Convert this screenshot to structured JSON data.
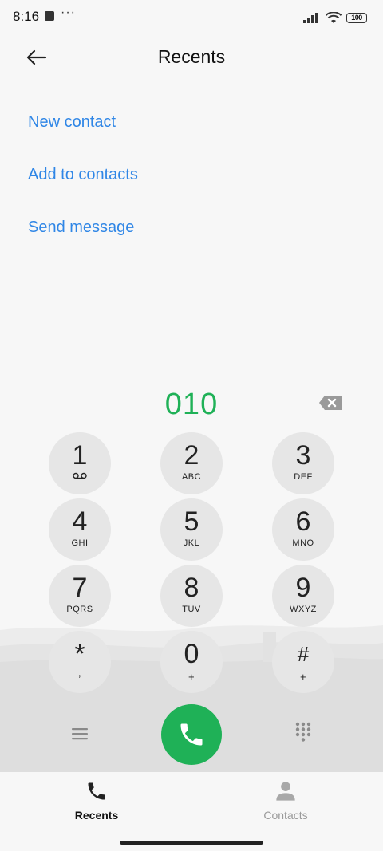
{
  "status_bar": {
    "time": "8:16",
    "dots": "···",
    "battery": "100"
  },
  "header": {
    "title": "Recents"
  },
  "actions": [
    {
      "label": "New contact"
    },
    {
      "label": "Add to contacts"
    },
    {
      "label": "Send message"
    }
  ],
  "dialer": {
    "number": "010",
    "accent_color": "#1fb157",
    "link_color": "#2f86e6"
  },
  "keypad": [
    {
      "digit": "1",
      "letters": ""
    },
    {
      "digit": "2",
      "letters": "ABC"
    },
    {
      "digit": "3",
      "letters": "DEF"
    },
    {
      "digit": "4",
      "letters": "GHI"
    },
    {
      "digit": "5",
      "letters": "JKL"
    },
    {
      "digit": "6",
      "letters": "MNO"
    },
    {
      "digit": "7",
      "letters": "PQRS"
    },
    {
      "digit": "8",
      "letters": "TUV"
    },
    {
      "digit": "9",
      "letters": "WXYZ"
    },
    {
      "digit": "*",
      "letters": ","
    },
    {
      "digit": "0",
      "letters": "+"
    },
    {
      "digit": "#",
      "letters": "+"
    }
  ],
  "bottom_nav": {
    "recents_label": "Recents",
    "contacts_label": "Contacts"
  }
}
